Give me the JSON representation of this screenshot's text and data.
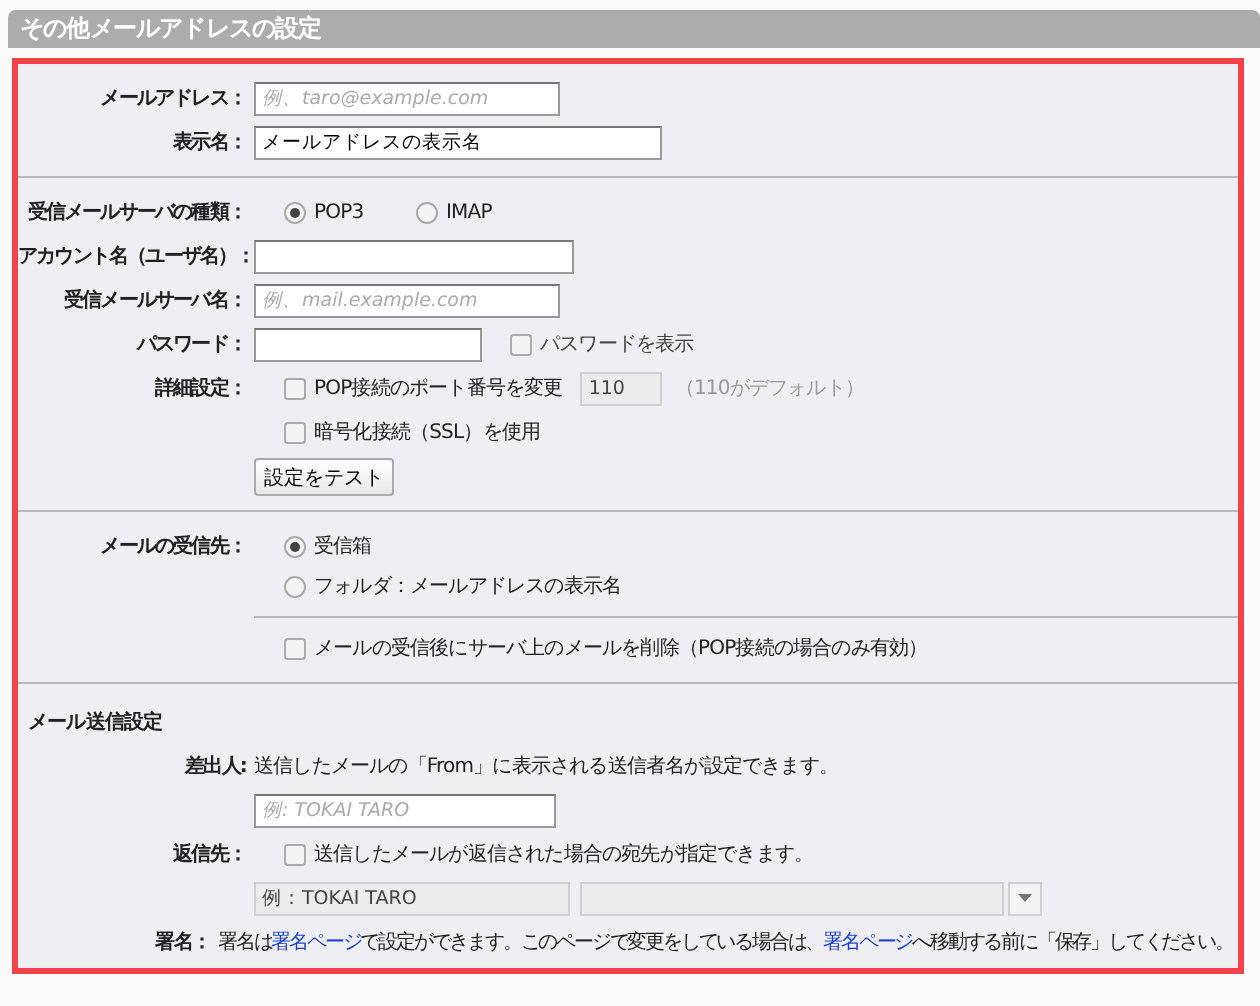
{
  "title": "その他メールアドレスの設定",
  "address": {
    "label": "メールアドレス：",
    "placeholder": "例、taro@example.com"
  },
  "display_name": {
    "label": "表示名：",
    "value": "メールアドレスの表示名"
  },
  "server_type": {
    "label": "受信メールサーバの種類：",
    "options": [
      {
        "label": "POP3",
        "selected": true
      },
      {
        "label": "IMAP",
        "selected": false
      }
    ]
  },
  "account": {
    "label": "アカウント名（ユーザ名）："
  },
  "server": {
    "label": "受信メールサーバ名：",
    "placeholder": "例、mail.example.com"
  },
  "password": {
    "label": "パスワード：",
    "show": {
      "label": "パスワードを表示",
      "checked": false
    }
  },
  "advanced": {
    "label": "詳細設定：",
    "port": {
      "label": "POP接続のポート番号を変更",
      "checked": false,
      "value": "110",
      "note": "（110がデフォルト）"
    },
    "ssl": {
      "label": "暗号化接続（SSL）を使用",
      "checked": false
    },
    "test_button": "設定をテスト"
  },
  "destination": {
    "label": "メールの受信先：",
    "options": [
      {
        "label": "受信箱",
        "selected": true
      },
      {
        "label": "フォルダ：メールアドレスの表示名",
        "selected": false
      }
    ],
    "delete": {
      "label": "メールの受信後にサーバ上のメールを削除（POP接続の場合のみ有効）",
      "checked": false
    }
  },
  "send": {
    "heading": "メール送信設定",
    "sender": {
      "label": "差出人:",
      "note": "送信したメールの「From」に表示される送信者名が設定できます。",
      "placeholder": "例: TOKAI TARO"
    },
    "reply": {
      "label": "返信先：",
      "checkbox": {
        "label": "送信したメールが返信された場合の宛先が指定できます。",
        "checked": false
      },
      "value": "例：TOKAI TARO"
    },
    "signature": {
      "label": "署名：",
      "parts": [
        {
          "kind": "text",
          "text": "署名は"
        },
        {
          "kind": "link",
          "text": "署名ページ"
        },
        {
          "kind": "text",
          "text": "で設定ができます。このページで変更をしている場合は、"
        },
        {
          "kind": "link",
          "text": "署名ページ"
        },
        {
          "kind": "text",
          "text": "へ移動する前に「保存」してください。"
        }
      ]
    }
  }
}
